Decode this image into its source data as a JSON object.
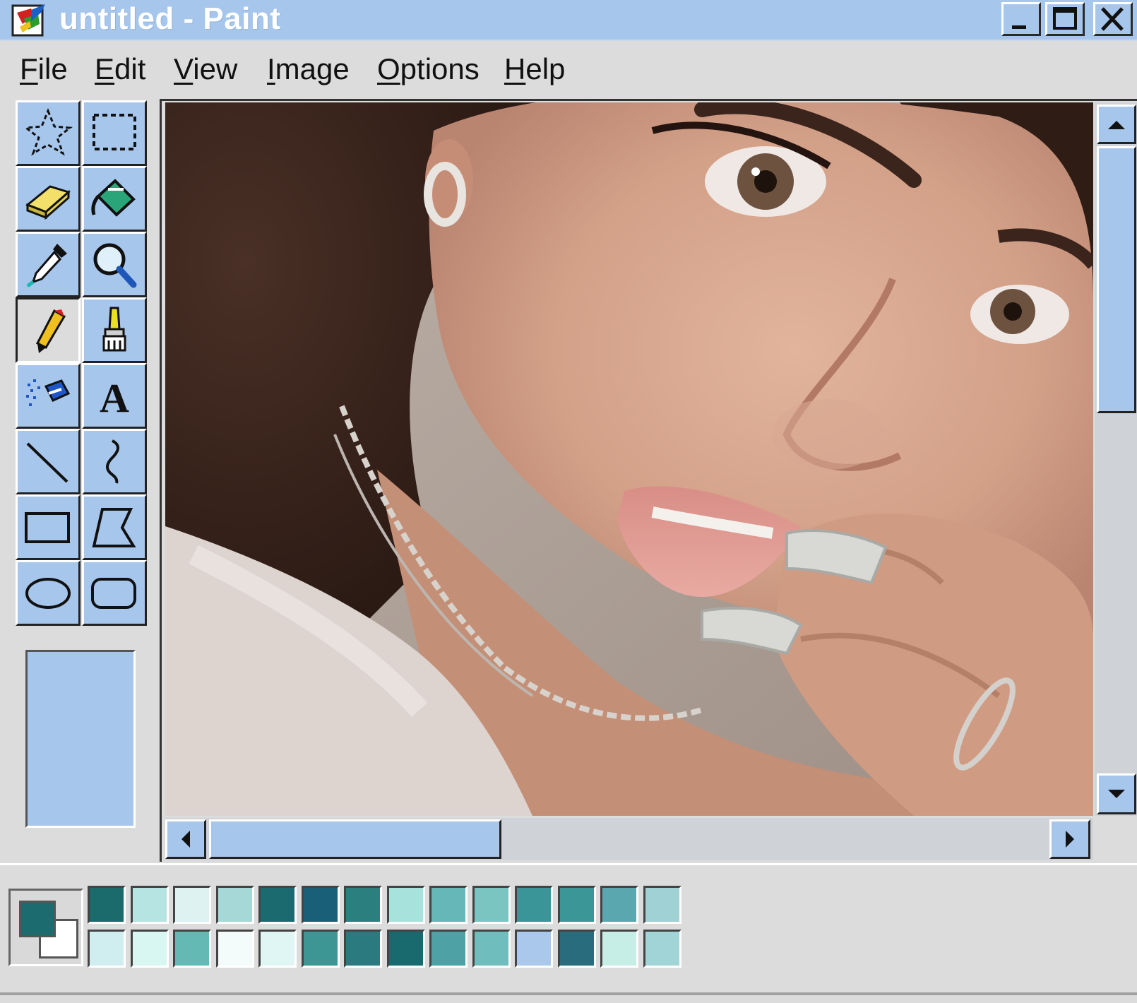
{
  "window": {
    "title": "untitled - Paint",
    "controls": {
      "minimize": "minimize-icon",
      "maximize": "maximize-icon",
      "close": "close-icon"
    }
  },
  "menu": [
    {
      "label": "File",
      "accel": "F",
      "rest": "ile"
    },
    {
      "label": "Edit",
      "accel": "E",
      "rest": "dit"
    },
    {
      "label": "View",
      "accel": "V",
      "rest": "iew"
    },
    {
      "label": "Image",
      "accel": "I",
      "rest": "mage"
    },
    {
      "label": "Options",
      "accel": "O",
      "rest": "ptions"
    },
    {
      "label": "Help",
      "accel": "H",
      "rest": "elp"
    }
  ],
  "tools": [
    {
      "name": "free-form-select",
      "icon": "star-select-icon"
    },
    {
      "name": "rect-select",
      "icon": "rect-select-icon"
    },
    {
      "name": "eraser",
      "icon": "eraser-icon"
    },
    {
      "name": "fill",
      "icon": "paint-bucket-icon"
    },
    {
      "name": "pick-color",
      "icon": "eyedropper-icon"
    },
    {
      "name": "magnifier",
      "icon": "magnifier-icon"
    },
    {
      "name": "pencil",
      "icon": "pencil-icon",
      "selected": true
    },
    {
      "name": "brush",
      "icon": "brush-icon"
    },
    {
      "name": "airbrush",
      "icon": "airbrush-icon"
    },
    {
      "name": "text",
      "icon": "text-icon",
      "glyph": "A"
    },
    {
      "name": "line",
      "icon": "line-icon"
    },
    {
      "name": "curve",
      "icon": "curve-icon"
    },
    {
      "name": "rectangle",
      "icon": "rectangle-icon"
    },
    {
      "name": "polygon",
      "icon": "polygon-icon"
    },
    {
      "name": "ellipse",
      "icon": "ellipse-icon"
    },
    {
      "name": "rounded-rectangle",
      "icon": "rounded-rectangle-icon"
    }
  ],
  "canvas": {
    "content": "photo"
  },
  "colors": {
    "foreground": "#1c6b6e",
    "background": "#ffffff",
    "chrome": "#a7c6ec",
    "palette_top": [
      "#1b6b6d",
      "#b6e4e2",
      "#def2f2",
      "#a6d8d8",
      "#1a6a70",
      "#195f77",
      "#2b7f7f",
      "#a8e2dc",
      "#66b8b8",
      "#7ac4c2",
      "#3a9599",
      "#3b9698",
      "#5ba7af",
      "#9fd1d5"
    ],
    "palette_bottom": [
      "#d0eef0",
      "#d8f6f2",
      "#64b9b5",
      "#f4fbfb",
      "#e0f6f4",
      "#3e9694",
      "#2a7a7f",
      "#186a6e",
      "#4ea1a4",
      "#6fbdbc",
      "#a9c8ec",
      "#286c7e",
      "#c6eee6",
      "#a0d4d6"
    ]
  }
}
